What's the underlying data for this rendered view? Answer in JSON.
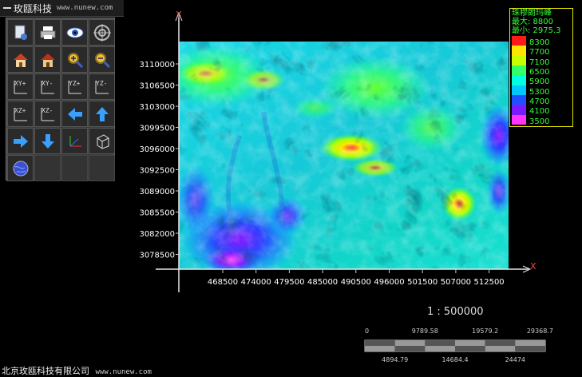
{
  "titlebar": {
    "app": "玫瓯科技",
    "url": "www.nunew.com"
  },
  "toolbar": {
    "buttons": [
      {
        "icon": "document-settings-icon"
      },
      {
        "icon": "printer-icon"
      },
      {
        "icon": "eye-icon"
      },
      {
        "icon": "target-icon"
      },
      {
        "icon": "home-icon"
      },
      {
        "icon": "home-alt-icon"
      },
      {
        "icon": "zoom-in-icon"
      },
      {
        "icon": "zoom-out-icon"
      },
      {
        "icon": "axis-xy-plus-icon",
        "label": "XY+"
      },
      {
        "icon": "axis-xy-minus-icon",
        "label": "XY-"
      },
      {
        "icon": "axis-yz-plus-icon",
        "label": "YZ+"
      },
      {
        "icon": "axis-yz-minus-icon",
        "label": "YZ-"
      },
      {
        "icon": "axis-xz-plus-icon",
        "label": "XZ+"
      },
      {
        "icon": "axis-xz-minus-icon",
        "label": "XZ-"
      },
      {
        "icon": "arrow-left-icon"
      },
      {
        "icon": "arrow-up-icon"
      },
      {
        "icon": "arrow-right-icon"
      },
      {
        "icon": "arrow-down-icon"
      },
      {
        "icon": "axes-3d-icon"
      },
      {
        "icon": "cube-icon"
      },
      {
        "icon": "globe-icon"
      }
    ]
  },
  "plot": {
    "y_axis_label": "Y",
    "x_axis_label": "X",
    "y_ticks": [
      "3110000",
      "3106500",
      "3103000",
      "3099500",
      "3096000",
      "3092500",
      "3089000",
      "3085500",
      "3082000",
      "3078500"
    ],
    "x_ticks": [
      "468500",
      "474000",
      "479500",
      "485000",
      "490500",
      "496000",
      "501500",
      "507000",
      "512500"
    ]
  },
  "legend": {
    "title": "珠穆朗玛峰",
    "max_label": "最大: 8800",
    "min_label": "最小: 2975.3",
    "levels": [
      "8300",
      "7700",
      "7100",
      "6500",
      "5900",
      "5300",
      "4700",
      "4100",
      "3500"
    ],
    "colors": [
      "#ff1a1a",
      "#ffe600",
      "#c8ff00",
      "#33ff66",
      "#00ffe0",
      "#00c8ff",
      "#1e50ff",
      "#7a1aff",
      "#ff33ff"
    ]
  },
  "scale": {
    "ratio": "1 : 500000",
    "top_ticks": [
      "0",
      "9789.58",
      "19579.2",
      "29368.7"
    ],
    "bottom_ticks": [
      "4894.79",
      "14684.4",
      "24474"
    ]
  },
  "footer": {
    "company": "北京玫瓯科技有限公司",
    "url": "www.nunew.com"
  }
}
